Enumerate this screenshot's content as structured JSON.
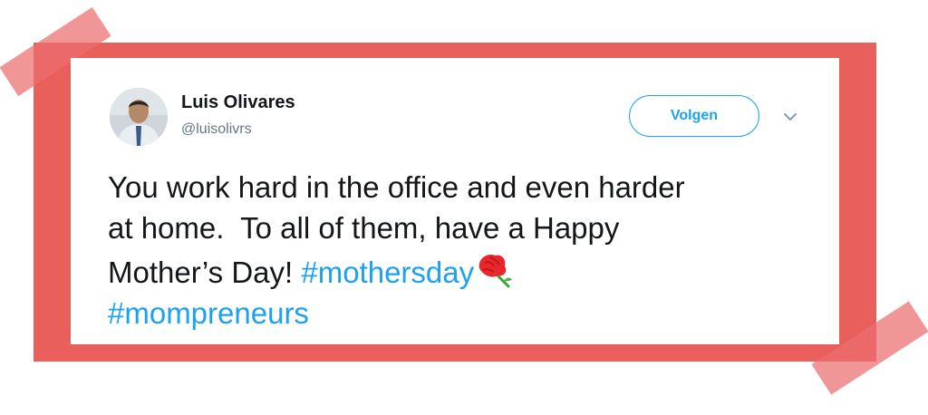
{
  "tweet": {
    "author_name": "Luis Olivares",
    "handle": "@luisolivrs",
    "follow_label": "Volgen",
    "text_line1": "You work hard in the office and even harder",
    "text_line2": "at home.  To all of them, have a Happy",
    "text_line3": "Mother’s Day! ",
    "hashtag1": "#mothersday",
    "hashtag2": "#mompreneurs"
  },
  "icons": {
    "avatar": "profile-photo",
    "menu": "chevron-down-icon",
    "emoji": "flower-icon"
  },
  "colors": {
    "frame": "#e85f5c",
    "tape": "#ec6e6e",
    "accent": "#1da1f2",
    "text": "#14171a",
    "muted": "#657786"
  }
}
